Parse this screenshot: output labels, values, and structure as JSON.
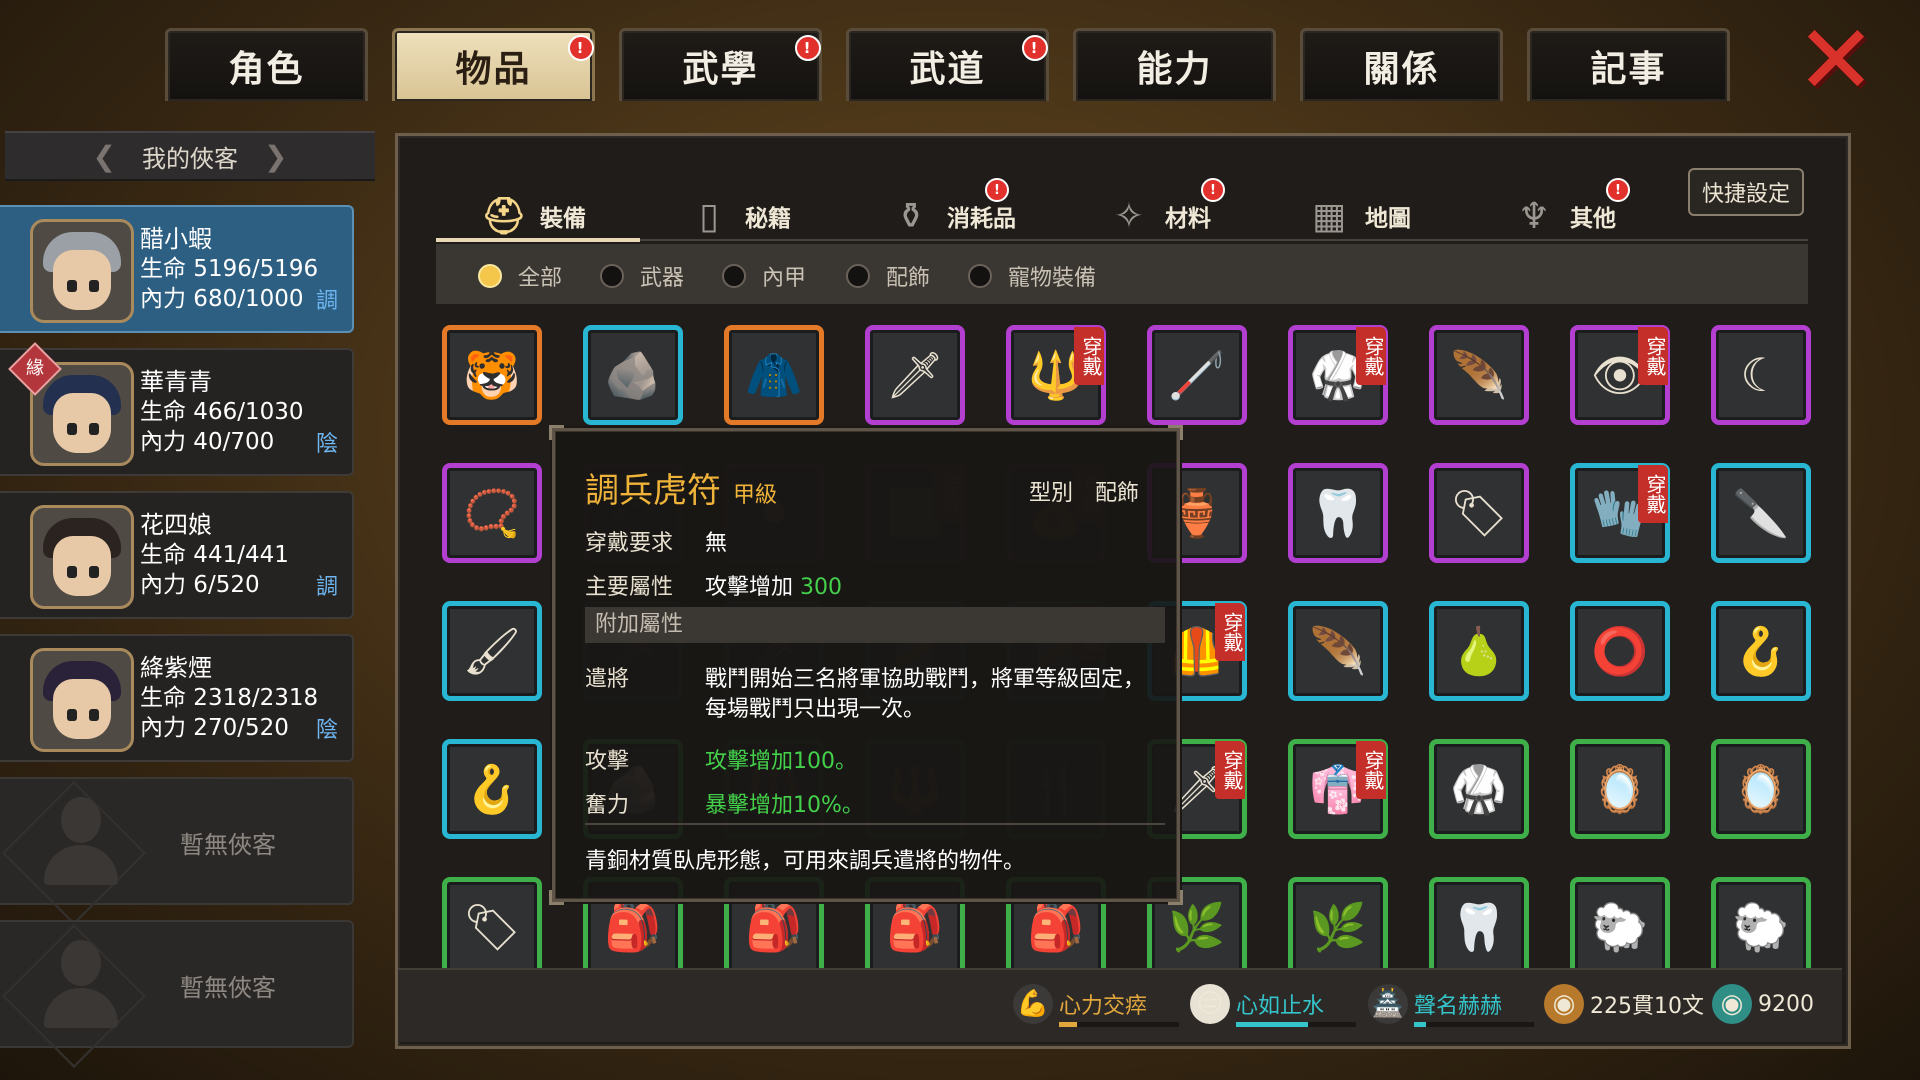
{
  "tabs": [
    {
      "label": "角色",
      "active": false,
      "alert": false
    },
    {
      "label": "物品",
      "active": true,
      "alert": true
    },
    {
      "label": "武學",
      "active": false,
      "alert": true
    },
    {
      "label": "武道",
      "active": false,
      "alert": true
    },
    {
      "label": "能力",
      "active": false,
      "alert": false
    },
    {
      "label": "關係",
      "active": false,
      "alert": false
    },
    {
      "label": "記事",
      "active": false,
      "alert": false
    }
  ],
  "alert_mark": "!",
  "heroes_header": "我的俠客",
  "heroes": [
    {
      "name": "醋小蝦",
      "hp": "生命 5196/5196",
      "mp": "內力 680/1000",
      "tag": "調",
      "selected": true,
      "yuan": false,
      "hair": "#9aa0a6"
    },
    {
      "name": "華青青",
      "hp": "生命 466/1030",
      "mp": "內力 40/700",
      "tag": "陰",
      "selected": false,
      "yuan": true,
      "hair": "#23304f"
    },
    {
      "name": "花四娘",
      "hp": "生命 441/441",
      "mp": "內力 6/520",
      "tag": "調",
      "selected": false,
      "yuan": false,
      "hair": "#2b2320"
    },
    {
      "name": "絳紫煙",
      "hp": "生命 2318/2318",
      "mp": "內力 270/520",
      "tag": "陰",
      "selected": false,
      "yuan": false,
      "hair": "#2a2238"
    }
  ],
  "yuan_label": "緣",
  "empty_slots": [
    "暫無俠客",
    "暫無俠客"
  ],
  "categories": [
    {
      "label": "裝備",
      "icon": "⛑",
      "alert": false,
      "active": true
    },
    {
      "label": "秘籍",
      "icon": "▯",
      "alert": false,
      "active": false
    },
    {
      "label": "消耗品",
      "icon": "⚱",
      "alert": true,
      "active": false
    },
    {
      "label": "材料",
      "icon": "✧",
      "alert": true,
      "active": false
    },
    {
      "label": "地圖",
      "icon": "▦",
      "alert": false,
      "active": false
    },
    {
      "label": "其他",
      "icon": "♆",
      "alert": true,
      "active": false
    }
  ],
  "quick_settings": "快捷設定",
  "filters": [
    {
      "label": "全部",
      "on": true
    },
    {
      "label": "武器",
      "on": false
    },
    {
      "label": "內甲",
      "on": false
    },
    {
      "label": "配飾",
      "on": false
    },
    {
      "label": "寵物裝備",
      "on": false
    }
  ],
  "worn_label": "穿戴",
  "items": [
    {
      "rarity": "orange",
      "icon": "🐯",
      "worn": false
    },
    {
      "rarity": "cyan",
      "icon": "🪨",
      "worn": false
    },
    {
      "rarity": "orange",
      "icon": "🧥",
      "worn": false
    },
    {
      "rarity": "purple",
      "icon": "🗡",
      "worn": false
    },
    {
      "rarity": "purple",
      "icon": "🔱",
      "worn": true
    },
    {
      "rarity": "purple",
      "icon": "🦯",
      "worn": false
    },
    {
      "rarity": "purple",
      "icon": "🥋",
      "worn": true
    },
    {
      "rarity": "purple",
      "icon": "🪶",
      "worn": false
    },
    {
      "rarity": "purple",
      "icon": "👁",
      "worn": true
    },
    {
      "rarity": "purple",
      "icon": "☾",
      "worn": false
    },
    {
      "rarity": "purple",
      "icon": "📿",
      "worn": false
    },
    {
      "rarity": "purple",
      "icon": "💣",
      "worn": false
    },
    {
      "rarity": "purple",
      "icon": "⚫",
      "worn": false
    },
    {
      "rarity": "purple",
      "icon": "🟩",
      "worn": true
    },
    {
      "rarity": "purple",
      "icon": "💰",
      "worn": true
    },
    {
      "rarity": "purple",
      "icon": "🏺",
      "worn": false
    },
    {
      "rarity": "purple",
      "icon": "🦷",
      "worn": false
    },
    {
      "rarity": "purple",
      "icon": "🏷",
      "worn": false
    },
    {
      "rarity": "cyan",
      "icon": "🧤",
      "worn": true
    },
    {
      "rarity": "cyan",
      "icon": "🔪",
      "worn": false
    },
    {
      "rarity": "cyan",
      "icon": "🖌",
      "worn": false
    },
    {
      "rarity": "cyan",
      "icon": "🗡",
      "worn": false
    },
    {
      "rarity": "cyan",
      "icon": "🗡",
      "worn": false
    },
    {
      "rarity": "cyan",
      "icon": "🎽",
      "worn": false
    },
    {
      "rarity": "cyan",
      "icon": "🎽",
      "worn": true
    },
    {
      "rarity": "cyan",
      "icon": "🦺",
      "worn": true
    },
    {
      "rarity": "cyan",
      "icon": "🪶",
      "worn": false
    },
    {
      "rarity": "cyan",
      "icon": "🍐",
      "worn": false
    },
    {
      "rarity": "cyan",
      "icon": "⭕",
      "worn": false
    },
    {
      "rarity": "cyan",
      "icon": "🪝",
      "worn": false
    },
    {
      "rarity": "cyan",
      "icon": "🪝",
      "worn": false
    },
    {
      "rarity": "green",
      "icon": "🪨",
      "worn": false
    },
    {
      "rarity": "green",
      "icon": "🔱",
      "worn": false
    },
    {
      "rarity": "green",
      "icon": "🔱",
      "worn": false
    },
    {
      "rarity": "green",
      "icon": "🍴",
      "worn": false
    },
    {
      "rarity": "green",
      "icon": "🗡",
      "worn": true
    },
    {
      "rarity": "green",
      "icon": "👘",
      "worn": true
    },
    {
      "rarity": "green",
      "icon": "🥋",
      "worn": false
    },
    {
      "rarity": "green",
      "icon": "🪞",
      "worn": false
    },
    {
      "rarity": "green",
      "icon": "🪞",
      "worn": false
    },
    {
      "rarity": "green",
      "icon": "🏷",
      "worn": false
    },
    {
      "rarity": "green",
      "icon": "🎒",
      "worn": false
    },
    {
      "rarity": "green",
      "icon": "🎒",
      "worn": false
    },
    {
      "rarity": "green",
      "icon": "🎒",
      "worn": false
    },
    {
      "rarity": "green",
      "icon": "🎒",
      "worn": false
    },
    {
      "rarity": "green",
      "icon": "🌿",
      "worn": false
    },
    {
      "rarity": "green",
      "icon": "🌿",
      "worn": false
    },
    {
      "rarity": "green",
      "icon": "🦷",
      "worn": false
    },
    {
      "rarity": "green",
      "icon": "🐑",
      "worn": false
    },
    {
      "rarity": "green",
      "icon": "🐑",
      "worn": false
    }
  ],
  "tooltip": {
    "title": "調兵虎符",
    "grade": "甲級",
    "type_label": "型別",
    "type_value": "配飾",
    "req_label": "穿戴要求",
    "req_value": "無",
    "main_label": "主要屬性",
    "main_value_prefix": "攻擊增加",
    "main_value_num": "300",
    "extra_label": "附加屬性",
    "attrs": [
      {
        "label": "遣將",
        "value_line1": "戰鬥開始三名將軍協助戰鬥，將軍等級固定，",
        "value_line2": "每場戰鬥只出現一次。",
        "green": false
      },
      {
        "label": "攻擊",
        "value_line1": "攻擊增加100。",
        "green": true
      },
      {
        "label": "奮力",
        "value_line1": "暴擊增加10%。",
        "green": true
      }
    ],
    "description": "青銅材質臥虎形態，可用來調兵遣將的物件。"
  },
  "status": [
    {
      "label": "心力交瘁",
      "icon": "💪",
      "color": "#e2a73c",
      "fill": 0.15,
      "icon_bg": "#3c3a38"
    },
    {
      "label": "心如止水",
      "icon": "😑",
      "color": "#35c4c9",
      "fill": 0.6,
      "icon_bg": "#e8e2d4"
    },
    {
      "label": "聲名赫赫",
      "icon": "🏯",
      "color": "#35c4c9",
      "fill": 0.1,
      "icon_bg": "#3c3a38"
    },
    {
      "label": "225貫10文",
      "icon": "◉",
      "color": "#d39a3b",
      "fill": 0,
      "icon_bg": "#b77a2c"
    },
    {
      "label": "9200",
      "icon": "◉",
      "color": "#3fb7a6",
      "fill": 0,
      "icon_bg": "#2f8f86"
    }
  ],
  "close_icon": "✕"
}
